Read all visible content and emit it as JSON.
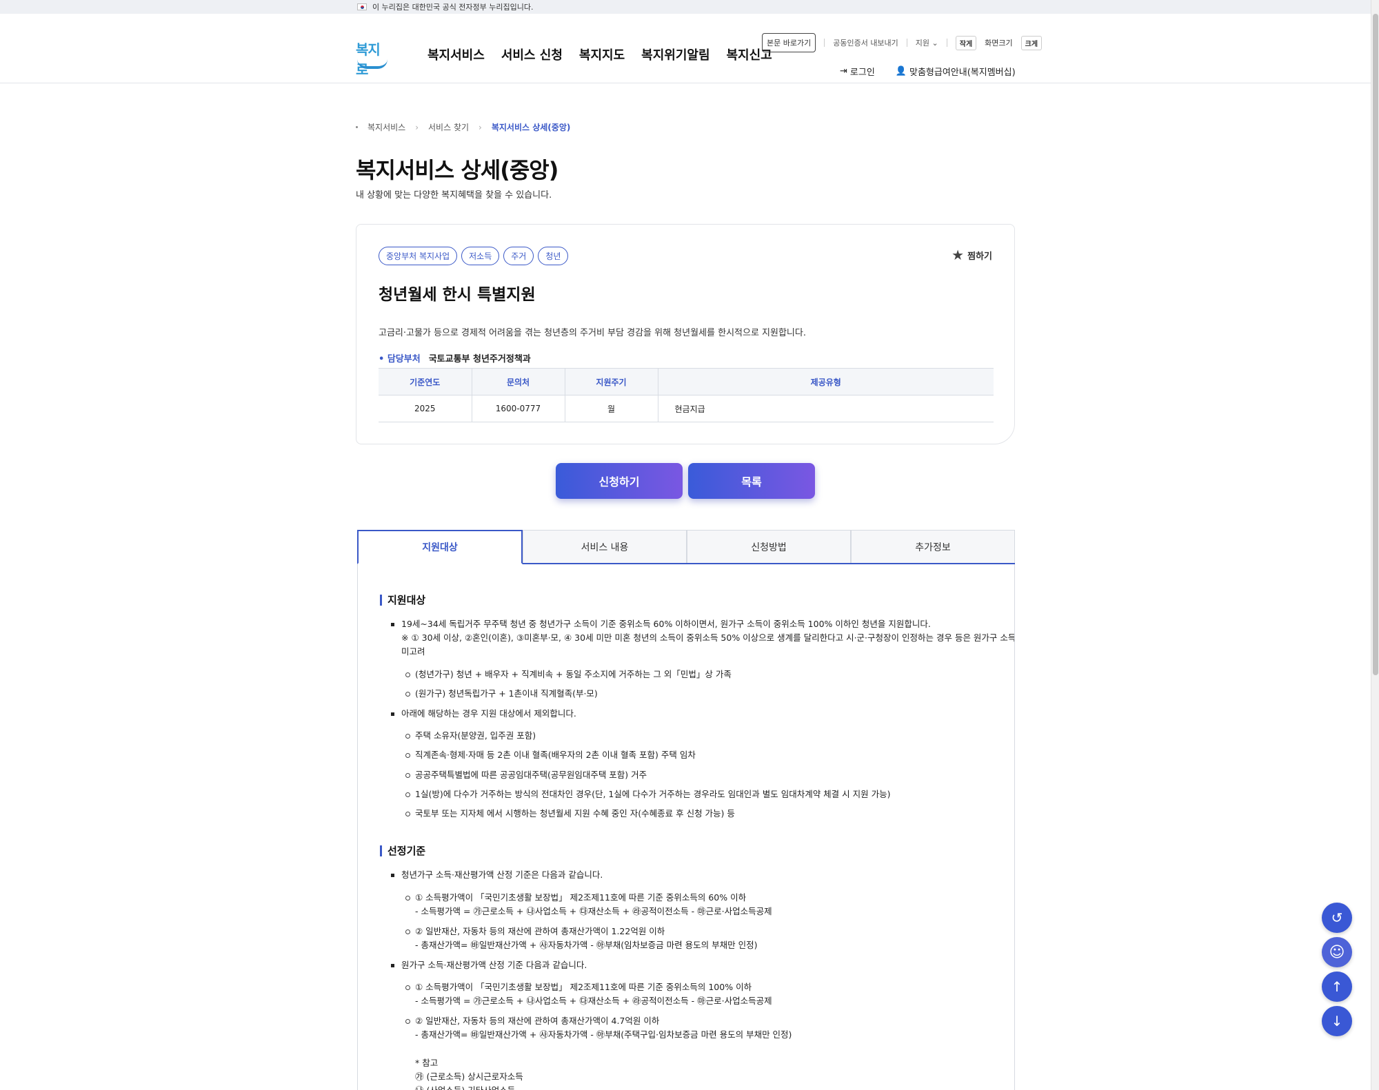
{
  "gov_banner": {
    "text": "이 누리집은 대한민국 공식 전자정부 누리집입니다."
  },
  "header": {
    "logo_text": "복지로",
    "gnb": [
      "복지서비스",
      "서비스 신청",
      "복지지도",
      "복지위기알림",
      "복지신고"
    ],
    "util": {
      "skip": "본문 바로가기",
      "cert": "공동인증서 내보내기",
      "support": "지원",
      "size_small": "작게",
      "size_label": "화면크기",
      "size_large": "크게"
    },
    "login": "로그인",
    "membership": "맞춤형급여안내(복지멤버십)"
  },
  "breadcrumb": [
    "복지서비스",
    "서비스 찾기",
    "복지서비스 상세(중앙)"
  ],
  "page": {
    "title": "복지서비스 상세(중앙)",
    "subtitle": "내 상황에 맞는 다양한 복지혜택을 찾을 수 있습니다."
  },
  "card": {
    "tags": [
      "중앙부처 복지사업",
      "저소득",
      "주거",
      "청년"
    ],
    "fav_label": "찜하기",
    "title": "청년월세 한시 특별지원",
    "description": "고금리·고물가 등으로 경제적 어려움을 겪는 청년층의 주거비 부담 경감을 위해 청년월세를 한시적으로 지원합니다.",
    "dept_label": "담당부처",
    "dept_value": "국토교통부 청년주거정책과",
    "table_headers": [
      "기준연도",
      "문의처",
      "지원주기",
      "제공유형"
    ],
    "table_values": [
      "2025",
      "1600-0777",
      "월",
      "현금지급"
    ]
  },
  "buttons": {
    "apply": "신청하기",
    "list": "목록"
  },
  "tabs": [
    "지원대상",
    "서비스 내용",
    "신청방법",
    "추가정보"
  ],
  "content": {
    "sec1_title": "지원대상",
    "sec1": [
      "19세~34세 독립거주 무주택 청년 중 청년가구 소득이 기준 중위소득 60% 이하이면서, 원가구 소득이 중위소득 100% 이하인 청년을 지원합니다.",
      "※ ① 30세 이상, ②혼인(이혼), ③미혼부·모, ④ 30세 미만 미혼 청년의 소득이 중위소득 50% 이상으로 생계를 달리한다고 시·군·구청장이 인정하는 경우 등은 원가구 소득",
      "미고려",
      "(청년가구) 청년 + 배우자 + 직계비속 + 동일 주소지에 거주하는 그 외「민법」상 가족",
      "(원가구) 청년독립가구 + 1촌이내 직계혈족(부·모)",
      "아래에 해당하는 경우 지원 대상에서 제외합니다.",
      "주택 소유자(분양권, 입주권 포함)",
      "직계존속·형제·자매 등 2촌 이내 혈족(배우자의 2촌 이내 혈족 포함) 주택 임차",
      "공공주택특별법에 따른 공공임대주택(공무원임대주택 포함) 거주",
      "1실(방)에 다수가 거주하는 방식의 전대차인 경우(단, 1실에 다수가 거주하는 경우라도 임대인과 별도 임대차계약 체결 시 지원 가능)",
      "국토부 또는 지자체 에서 시행하는 청년월세 지원 수혜 중인 자(수혜종료 후 신청 가능) 등"
    ],
    "sec2_title": "선정기준",
    "sec2": [
      "청년가구 소득·재산평가액 산정 기준은 다음과 같습니다.",
      "① 소득평가액이 「국민기초생활 보장법」 제2조제11호에 따른 기준 중위소득의 60% 이하",
      "- 소득평가액 = ㉮근로소득 + ㉯사업소득 + ㉰재산소득 + ㉱공적이전소득 - ㉲근로·사업소득공제",
      "② 일반재산, 자동차 등의 재산에 관하여 총재산가액이 1.22억원 이하",
      "- 총재산가액= ㉳일반재산가액 + ㉴자동차가액 - ㉵부채(임차보증금 마련 용도의 부채만 인정)",
      "원가구 소득·재산평가액 산정 기준 다음과 같습니다.",
      "① 소득평가액이 「국민기초생활 보장법」 제2조제11호에 따른 기준 중위소득의 100% 이하",
      "- 소득평가액 = ㉮근로소득 + ㉯사업소득 + ㉰재산소득 + ㉱공적이전소득 - ㉲근로·사업소득공제",
      "② 일반재산, 자동차 등의 재산에 관하여 총재산가액이 4.7억원 이하",
      "- 총재산가액= ㉳일반재산가액 + ㉴자동차가액 - ㉵부채(주택구입·임차보증금 마련 용도의 부채만 인정)",
      "* 참고",
      "㉮ (근로소득) 상시근로자소득",
      "㉯ (사업소득) 기타사업소득"
    ]
  },
  "colors": {
    "accent": "#3a58c7",
    "button_from": "#3a5bd9",
    "button_to": "#7a57e2"
  }
}
